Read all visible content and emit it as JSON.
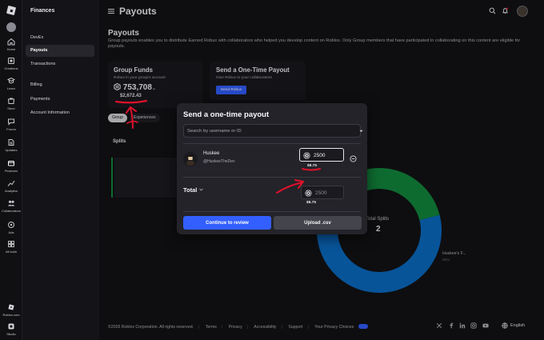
{
  "app": {
    "section": "Finances",
    "page_header": "Payouts"
  },
  "rail": [
    {
      "label": "Home",
      "icon": "home-icon"
    },
    {
      "label": "Creations",
      "icon": "creations-icon"
    },
    {
      "label": "Learn",
      "icon": "learn-icon"
    },
    {
      "label": "Store",
      "icon": "store-icon"
    },
    {
      "label": "Forum",
      "icon": "forum-icon"
    },
    {
      "label": "Updates",
      "icon": "updates-icon"
    },
    {
      "label": "Finances",
      "icon": "finances-icon"
    },
    {
      "label": "Analytics",
      "icon": "analytics-icon"
    },
    {
      "label": "Collaborators",
      "icon": "collaborators-icon"
    },
    {
      "label": "Ads",
      "icon": "ads-icon"
    },
    {
      "label": "All tools",
      "icon": "all-tools-icon"
    },
    {
      "label": "Roblox.com",
      "icon": "roblox-logo-icon"
    },
    {
      "label": "Studio",
      "icon": "studio-icon"
    }
  ],
  "sidenav": {
    "items": [
      "DevEx",
      "Payouts",
      "Transactions",
      "Billing",
      "Payments",
      "Account Information"
    ],
    "active": "Payouts"
  },
  "main": {
    "title": "Payouts",
    "description": "Group payouts enables you to distribute Earned Robux with collaborators who helped you develop content on Roblox. Only Group members that have participated in collaborating on this content are eligible for payouts.",
    "group_funds": {
      "title": "Group Funds",
      "subtitle": "Robux in your group's account",
      "robux": "753,708",
      "usd": "$2,672.43"
    },
    "one_time": {
      "title": "Send a One-Time Payout",
      "subtitle": "Give Robux to your collaborators",
      "button": "Send Robux"
    },
    "chips": [
      "Group",
      "Experiences"
    ],
    "splits_title": "Splits",
    "donut": {
      "center_label": "Total Splits",
      "center_count": "2",
      "legend_name": "Huskee's F...",
      "legend_pct": "65%",
      "segments": [
        {
          "value": 65,
          "color": "#0b6cc4"
        },
        {
          "value": 35,
          "color": "#138a3e"
        }
      ]
    }
  },
  "modal": {
    "title": "Send a one-time payout",
    "search_placeholder": "Search by username or ID",
    "recipient": {
      "name": "Huskee",
      "handle": "@HuskeeTheDev",
      "amount": "2500",
      "usd": "$8.75"
    },
    "total": {
      "label": "Total",
      "amount": "2500",
      "usd": "$8.75"
    },
    "primary_button": "Continue to review",
    "secondary_button": "Upload .csv"
  },
  "footer": {
    "copyright": "©2026 Roblox Corporation. All rights reserved.",
    "links": [
      "Terms",
      "Privacy",
      "Accessibility",
      "Support",
      "Your Privacy Choices"
    ],
    "language": "English",
    "social": [
      "x-icon",
      "facebook-icon",
      "linkedin-icon",
      "instagram-icon",
      "youtube-icon"
    ]
  },
  "colors": {
    "accent": "#335fff",
    "annotation": "#e0112b",
    "donut_blue": "#0b6cc4",
    "donut_green": "#138a3e"
  }
}
